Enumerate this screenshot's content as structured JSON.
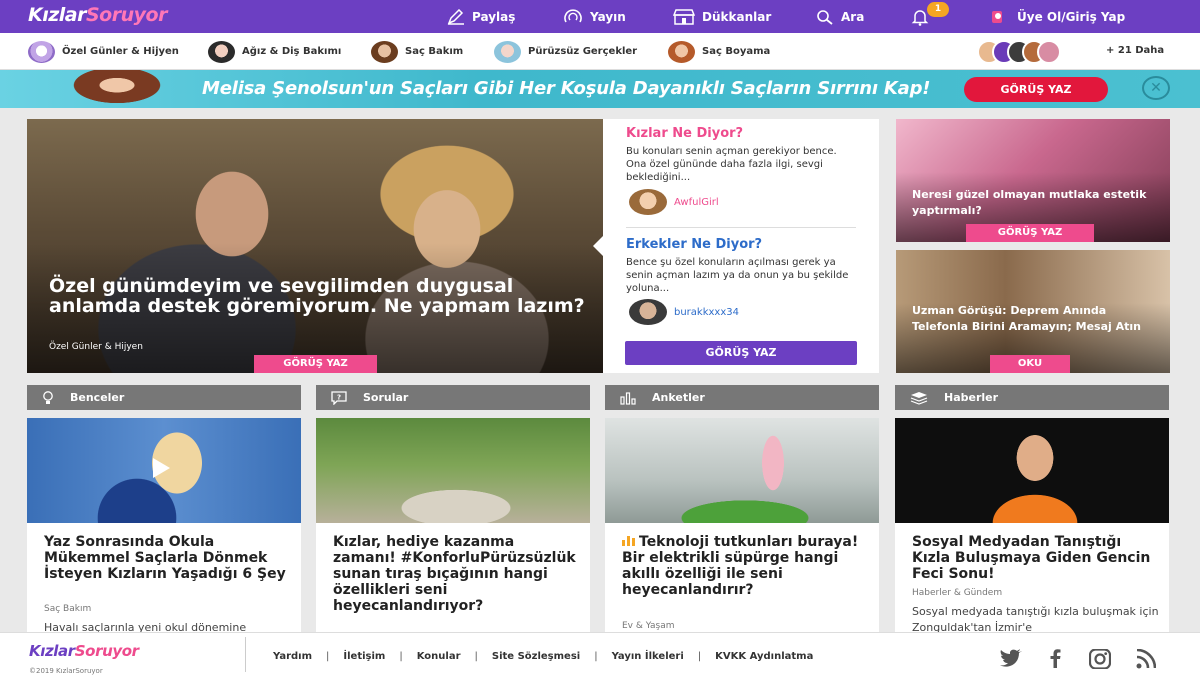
{
  "colors": {
    "brand_purple": "#6c3fc2",
    "accent_pink": "#ee4b8d",
    "accent_blue": "#2d6cc9",
    "banner_red": "#e2173c",
    "notification": "#f5a623"
  },
  "header": {
    "logo_part1": "Kızlar",
    "logo_part2": "Soruyor",
    "nav": [
      {
        "label": "Paylaş",
        "icon": "pen-icon"
      },
      {
        "label": "Yayın",
        "icon": "broadcast-icon"
      },
      {
        "label": "Dükkanlar",
        "icon": "store-icon"
      },
      {
        "label": "Ara",
        "icon": "search-icon"
      }
    ],
    "notification_count": "1",
    "login_label": "Üye Ol/Giriş Yap"
  },
  "categories": {
    "items": [
      {
        "label": "Özel Günler & Hijyen"
      },
      {
        "label": "Ağız & Diş Bakımı"
      },
      {
        "label": "Saç Bakım"
      },
      {
        "label": "Pürüzsüz Gerçekler"
      },
      {
        "label": "Saç Boyama"
      }
    ],
    "more_label": "+ 21 Daha"
  },
  "banner": {
    "text": "Melisa Şenolsun'un Saçları Gibi Her Koşula Dayanıklı Saçların Sırrını Kap!",
    "button_label": "GÖRÜŞ YAZ",
    "close_glyph": "✕"
  },
  "hero": {
    "title": "Özel günümdeyim ve sevgilimden duygusal anlamda destek göremiyorum. Ne yapmam lazım?",
    "category": "Özel Günler & Hijyen",
    "button_label": "GÖRÜŞ YAZ"
  },
  "opinions": {
    "girls_title": "Kızlar Ne Diyor?",
    "girls_text": "Bu konuları senin açman gerekiyor bence. Ona özel gününde daha fazla ilgi, sevgi beklediğini...",
    "girls_user": "AwfulGirl",
    "boys_title": "Erkekler Ne Diyor?",
    "boys_text": "Bence şu özel konuların açılması gerek ya senin açman lazım ya da onun ya bu şekilde yoluna...",
    "boys_user": "burakkxxx34",
    "button_label": "GÖRÜŞ YAZ"
  },
  "side_cards": [
    {
      "title": "Neresi güzel olmayan mutlaka estetik yaptırmalı?",
      "button_label": "GÖRÜŞ YAZ"
    },
    {
      "title": "Uzman Görüşü: Deprem Anında Telefonla Birini Aramayın; Mesaj Atın",
      "button_label": "OKU"
    }
  ],
  "sections": [
    {
      "label": "Benceler",
      "icon": "lightbulb-icon"
    },
    {
      "label": "Sorular",
      "icon": "question-bubble-icon"
    },
    {
      "label": "Anketler",
      "icon": "bar-chart-icon"
    },
    {
      "label": "Haberler",
      "icon": "newspaper-icon"
    }
  ],
  "cards": [
    {
      "title": "Yaz Sonrasında Okula Mükemmel Saçlarla Dönmek İsteyen Kızların Yaşadığı 6 Şey",
      "category": "Saç Bakım",
      "excerpt": "Havalı saçlarınla yeni okul dönemine"
    },
    {
      "title": "Kızlar, hediye kazanma zamanı! #KonforluPürüzsüzlük sunan tıraş bıçağının hangi özellikleri seni heyecanlandırıyor?",
      "category": "",
      "excerpt": ""
    },
    {
      "title": "Teknoloji tutkunları buraya! Bir elektrikli süpürge hangi akıllı özelliği ile seni heyecanlandırır?",
      "category": "Ev & Yaşam",
      "excerpt": ""
    },
    {
      "title": "Sosyal Medyadan Tanıştığı Kızla Buluşmaya Giden Gencin Feci Sonu!",
      "category": "Haberler & Gündem",
      "excerpt": "Sosyal medyada tanıştığı kızla buluşmak için Zonguldak'tan İzmir'e"
    }
  ],
  "footer": {
    "logo_part1": "Kızlar",
    "logo_part2": "Soruyor",
    "copyright": "©2019 KızlarSoruyor",
    "links": [
      "Yardım",
      "İletişim",
      "Konular",
      "Site Sözleşmesi",
      "Yayın İlkeleri",
      "KVKK Aydınlatma"
    ],
    "social": [
      "twitter-icon",
      "facebook-icon",
      "instagram-icon",
      "rss-icon"
    ]
  }
}
